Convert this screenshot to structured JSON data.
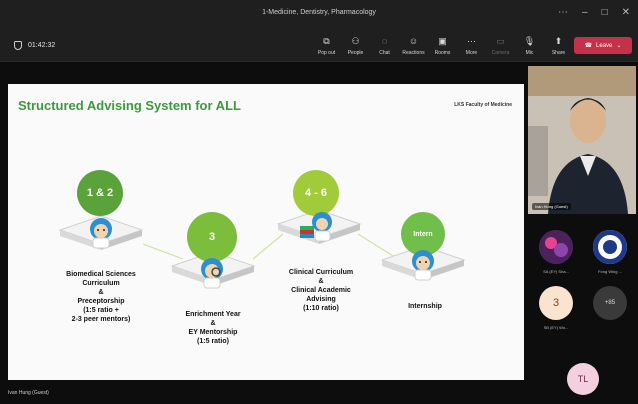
{
  "window": {
    "title": "1-Medicine, Dentistry, Pharmacology"
  },
  "meeting": {
    "timer": "01:42:32"
  },
  "toolbar": {
    "items": [
      {
        "label": "Pop out",
        "icon": "popout-icon"
      },
      {
        "label": "People",
        "icon": "people-icon"
      },
      {
        "label": "Chat",
        "icon": "chat-icon"
      },
      {
        "label": "Reactions",
        "icon": "reactions-icon"
      },
      {
        "label": "Rooms",
        "icon": "rooms-icon"
      },
      {
        "label": "More",
        "icon": "more-icon"
      },
      {
        "label": "Camera",
        "icon": "camera-icon",
        "disabled": true
      },
      {
        "label": "Mic",
        "icon": "mic-icon"
      },
      {
        "label": "Share",
        "icon": "share-icon"
      }
    ],
    "leave_label": "Leave",
    "leave_color": "#c4314b"
  },
  "slide": {
    "title": "Structured Advising System for ALL",
    "brand": "LKS Faculty of Medicine",
    "nodes": [
      {
        "badge": "1 & 2",
        "label_lines": [
          "Biomedical Sciences",
          "Curriculum",
          "&",
          "Preceptorship",
          "(1:5 ratio +",
          "2-3 peer mentors)"
        ]
      },
      {
        "badge": "3",
        "label_lines": [
          "Enrichment Year",
          "&",
          "EY Mentorship",
          "(1:5 ratio)"
        ]
      },
      {
        "badge": "4 - 6",
        "label_lines": [
          "Clinical Curriculum",
          "&",
          "Clinical Academic",
          "Advising",
          "(1:10 ratio)"
        ]
      },
      {
        "badge": "Intern",
        "label_lines": [
          "Internship"
        ]
      }
    ],
    "colors": {
      "title": "#3c9a3c",
      "dark_green": "#5aa33a",
      "light_green": "#b7d63f"
    }
  },
  "presenter_nameplate": "Ivan Hung (Guest)",
  "video": {
    "name": "Ivan Hung (Guest)"
  },
  "participants": [
    {
      "name": "SA (EY) Sha...",
      "type": "image-purple"
    },
    {
      "name": "Fong Wing ...",
      "type": "crest"
    },
    {
      "name": "SB (EY) Wo...",
      "type": "number",
      "text": "3"
    },
    {
      "name": "",
      "type": "more",
      "text": "+85"
    }
  ],
  "self_avatar": {
    "initials": "TL"
  }
}
